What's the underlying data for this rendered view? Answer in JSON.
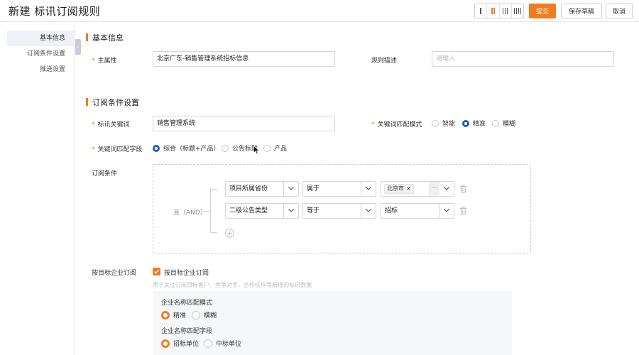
{
  "header": {
    "title": "新建 标讯订阅规则",
    "submit_label": "提交",
    "save_draft_label": "保存草稿",
    "cancel_label": "取消"
  },
  "sidebar": {
    "items": [
      {
        "label": "基本信息"
      },
      {
        "label": "订阅条件设置"
      },
      {
        "label": "推送设置"
      }
    ]
  },
  "basic": {
    "section_title": "基本信息",
    "owner_label": "主属性",
    "owner_value": "北京广东-销售管理系统招标信息",
    "desc_label": "规则描述",
    "desc_placeholder": "请输入"
  },
  "conditions": {
    "section_title": "订阅条件设置",
    "keyword_label": "标讯关键词",
    "keyword_value": "销售管理系统",
    "match_mode_label": "关键词匹配模式",
    "match_mode_options": [
      "智能",
      "精准",
      "模糊"
    ],
    "match_mode_selected": "精准",
    "match_field_label": "关键词匹配字段",
    "match_field_options": [
      "综合（标题+产品）",
      "公告标题",
      "产品"
    ],
    "match_field_selected": "综合（标题+产品）",
    "cond_label": "订阅条件",
    "logic_label": "且（AND）",
    "rows": [
      {
        "field": "项目所属省份",
        "operator": "属于",
        "value_tag": "北京市",
        "tag_close": "×",
        "more": "···"
      },
      {
        "field": "二级公告类型",
        "operator": "等于",
        "value": "招标"
      }
    ]
  },
  "target": {
    "label": "按目标企业订阅",
    "checkbox_label": "按目标企业订阅",
    "hint": "用于关注订阅目标客户、竞争对手、合作伙伴等新增的标讯数据",
    "name_mode_label": "企业名称匹配模式",
    "name_mode_options": [
      "精准",
      "模糊"
    ],
    "name_mode_selected": "精准",
    "name_field_label": "企业名称匹配字段",
    "name_field_options": [
      "招标单位",
      "中标单位"
    ],
    "name_field_selected": "招标单位"
  },
  "colors": {
    "accent": "#f07c22",
    "radio_blue": "#1f5fbf"
  }
}
